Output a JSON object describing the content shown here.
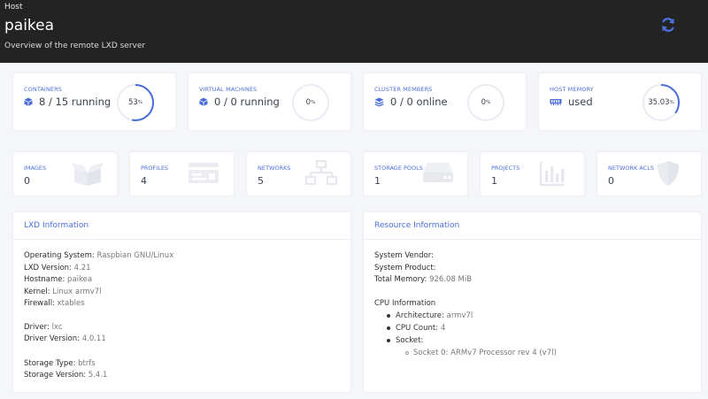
{
  "header": {
    "breadcrumb": "Host",
    "title": "paikea",
    "subtitle": "Overview of the remote LXD server",
    "refresh_icon": "refresh-icon"
  },
  "stats": [
    {
      "label": "Containers",
      "value": "8 / 15 running",
      "percent_text": "53",
      "fraction": 0.53,
      "icon": "cube-icon"
    },
    {
      "label": "Virtual Machines",
      "value": "0 / 0 running",
      "percent_text": "0",
      "fraction": 0,
      "icon": "cube-icon"
    },
    {
      "label": "Cluster Members",
      "value": "0 / 0 online",
      "percent_text": "0",
      "fraction": 0,
      "icon": "layers-icon"
    },
    {
      "label": "Host Memory",
      "value": "used",
      "percent_text": "35.03",
      "fraction": 0.3503,
      "icon": "memory-icon"
    }
  ],
  "percent_sign": "%",
  "counts": [
    {
      "label": "Images",
      "value": "0",
      "icon": "box-icon"
    },
    {
      "label": "Profiles",
      "value": "4",
      "icon": "id-card-icon"
    },
    {
      "label": "Networks",
      "value": "5",
      "icon": "network-icon"
    },
    {
      "label": "Storage Pools",
      "value": "1",
      "icon": "hdd-icon"
    },
    {
      "label": "Projects",
      "value": "1",
      "icon": "chart-icon"
    },
    {
      "label": "Network ACLs",
      "value": "0",
      "icon": "shield-icon"
    }
  ],
  "lxd_info": {
    "heading": "LXD Information",
    "rows": [
      {
        "key": "Operating System",
        "value": "Raspbian GNU/Linux"
      },
      {
        "key": "LXD Version",
        "value": "4.21"
      },
      {
        "key": "Hostname",
        "value": "paikea"
      },
      {
        "key": "Kernel",
        "value": "Linux armv7l"
      },
      {
        "key": "Firewall",
        "value": "xtables"
      },
      {
        "key": "Driver",
        "value": "lxc"
      },
      {
        "key": "Driver Version",
        "value": "4.0.11"
      },
      {
        "key": "Storage Type",
        "value": "btrfs"
      },
      {
        "key": "Storage Version",
        "value": "5.4.1"
      }
    ]
  },
  "resource_info": {
    "heading": "Resource Information",
    "system_vendor_label": "System Vendor",
    "system_product_label": "System Product",
    "total_memory_label": "Total Memory",
    "total_memory_value": "926.08 MiB",
    "cpu_heading": "CPU Information",
    "architecture_label": "Architecture",
    "architecture_value": "armv7l",
    "cpu_count_label": "CPU Count",
    "cpu_count_value": "4",
    "socket_label": "Socket",
    "socket_item": "Socket 0: ARMv7 Processor rev 4 (v7l)"
  },
  "colors": {
    "accent": "#4b6edb",
    "header_bg": "#232323",
    "page_bg": "#f5f6fa",
    "gauge_track": "#e9ecf2"
  }
}
